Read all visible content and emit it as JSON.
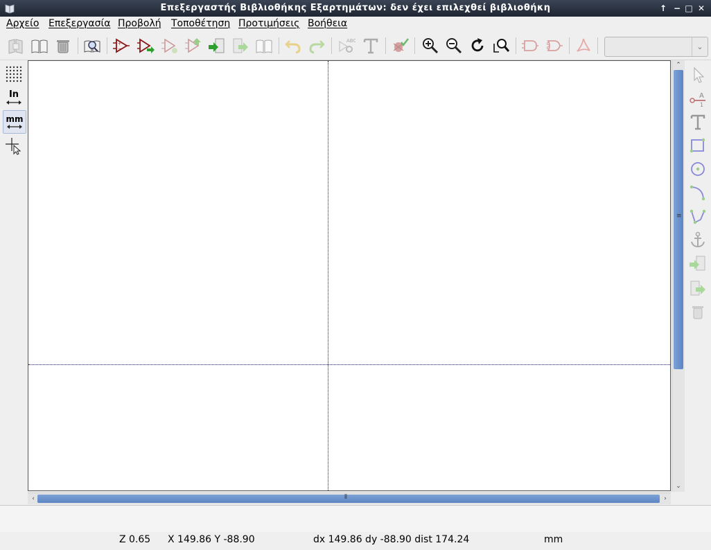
{
  "window": {
    "title": "Επεξεργαστής Βιβλιοθήκης Εξαρτημάτων: δεν έχει επιλεχθεί βιβλιοθήκη",
    "controls": [
      "↑",
      "−",
      "□",
      "✕"
    ]
  },
  "menu": {
    "items": [
      "Αρχείο",
      "Επεξεργασία",
      "Προβολή",
      "Τοποθέτηση",
      "Προτιμήσεις",
      "Βοήθεια"
    ]
  },
  "toolbar": {
    "combo_value": "",
    "combo_arrow": "⌄"
  },
  "left_toolbar": {
    "in_label": "In",
    "mm_label": "mm"
  },
  "right_toolbar": {
    "pin_label_a": "A",
    "pin_label_1": "1"
  },
  "status": {
    "zoom": "Z 0.65",
    "xy": "X 149.86  Y -88.90",
    "delta": "dx 149.86  dy -88.90  dist 174.24",
    "units": "mm"
  },
  "colors": {
    "component_red": "#8b1414",
    "draw_blue": "#7a7ad8",
    "green": "#2e9e2e",
    "scroll_blue": "#6a93cf"
  }
}
